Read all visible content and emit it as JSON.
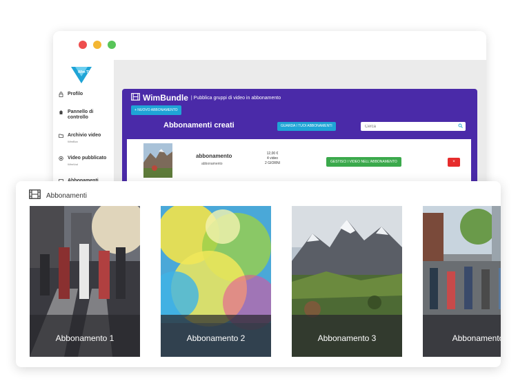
{
  "sidebar": {
    "logo_text": "Wim TV",
    "items": [
      {
        "label": "Profilo",
        "sub": "",
        "icon": "lock-icon"
      },
      {
        "label": "Pannello di controllo",
        "sub": "",
        "icon": "home-icon"
      },
      {
        "label": "Archivio video",
        "sub": "WimBox",
        "icon": "folder-icon"
      },
      {
        "label": "Video pubblicato",
        "sub": "WimVod",
        "icon": "play-circle-icon"
      },
      {
        "label": "Abbonamenti",
        "sub": "",
        "icon": "film-icon"
      }
    ]
  },
  "wimbundle": {
    "title": "WimBundle",
    "subtitle": "| Pubblica gruppi di video in abbonamento",
    "new_button": "+ NUOVO ABBONAMENTO"
  },
  "list": {
    "title": "Abbonamenti creati",
    "view_all_button": "GUARDA I TUOI ABBONAMENTI",
    "search_placeholder": "Cerca",
    "rows": [
      {
        "name": "abbonamento",
        "sub": "abbonamento",
        "price": "12,00 €",
        "videos": "4 video",
        "duration": "2 GIORNI",
        "manage_button": "GESTISCI I VIDEO NELL'ABBONAMENTO",
        "delete_button": "×"
      }
    ]
  },
  "card": {
    "title": "Abbonamenti",
    "tiles": [
      {
        "label": "Abbonamento 1"
      },
      {
        "label": "Abbonamento 2"
      },
      {
        "label": "Abbonamento 3"
      },
      {
        "label": "Abbonamento"
      }
    ]
  },
  "colors": {
    "accent_purple": "#4a2aa8",
    "button_blue": "#1fa4d6",
    "button_green": "#3ba94c",
    "button_red": "#e62c2c"
  }
}
